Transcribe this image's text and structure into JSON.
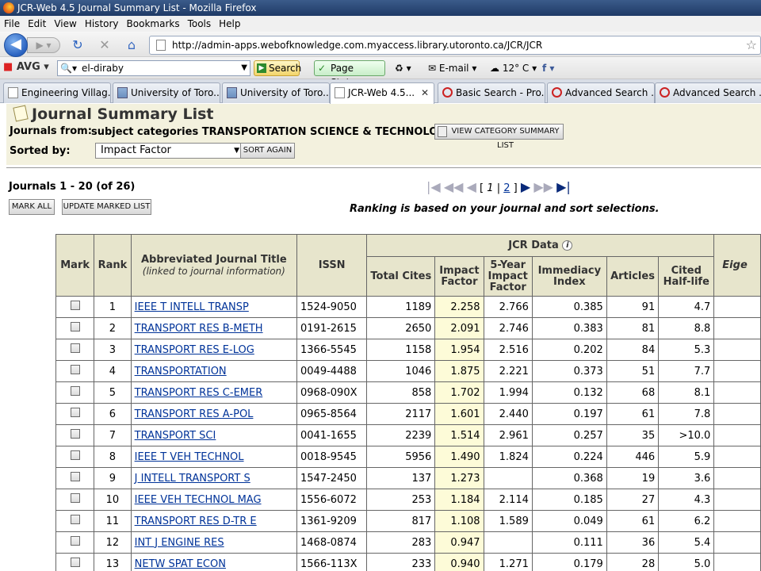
{
  "window": {
    "title": "JCR-Web 4.5 Journal Summary List - Mozilla Firefox"
  },
  "menu": [
    "File",
    "Edit",
    "View",
    "History",
    "Bookmarks",
    "Tools",
    "Help"
  ],
  "nav": {
    "url": "http://admin-apps.webofknowledge.com.myaccess.library.utoronto.ca/JCR/JCR"
  },
  "toolbar2": {
    "avg": "AVG",
    "search_value": "el-diraby",
    "search_btn": "Search",
    "page_status": "Page Status",
    "email": "E-mail",
    "weather": "12° C"
  },
  "tabs": [
    {
      "label": "Engineering Villag...",
      "icon": "doc"
    },
    {
      "label": "University of Toro...",
      "icon": "img"
    },
    {
      "label": "University of Toro...",
      "icon": "img"
    },
    {
      "label": "JCR-Web 4.5...",
      "icon": "doc",
      "active": true
    },
    {
      "label": "Basic Search - Pro...",
      "icon": "q"
    },
    {
      "label": "Advanced Search ...",
      "icon": "q"
    },
    {
      "label": "Advanced Search ...",
      "icon": "q"
    }
  ],
  "page": {
    "title": "Journal Summary List",
    "journals_from_label": "Journals from:",
    "journals_from_value": "subject categories TRANSPORTATION SCIENCE & TECHNOLOGY",
    "view_category_btn": "VIEW CATEGORY SUMMARY LIST",
    "sorted_by_label": "Sorted by:",
    "sorted_by_value": "Impact Factor",
    "sort_again_btn": "SORT AGAIN",
    "journals_count": "Journals 1 - 20 (of 26)",
    "mark_all_btn": "MARK ALL",
    "update_marked_btn": "UPDATE MARKED LIST",
    "pager": {
      "current": "1",
      "next": "2"
    },
    "ranking_note": "Ranking is based on your journal and sort selections."
  },
  "table": {
    "headers": {
      "mark": "Mark",
      "rank": "Rank",
      "title": "Abbreviated Journal Title",
      "title_sub": "(linked to journal information)",
      "issn": "ISSN",
      "jcr_data": "JCR Data",
      "total_cites": "Total Cites",
      "impact_factor": "Impact Factor",
      "five_year": "5-Year Impact Factor",
      "immediacy": "Immediacy Index",
      "articles": "Articles",
      "cited_half_life": "Cited Half-life",
      "eigen": "Eige"
    },
    "rows": [
      {
        "rank": "1",
        "title": "IEEE T INTELL TRANSP",
        "issn": "1524-9050",
        "total_cites": "1189",
        "impact": "2.258",
        "five_year": "2.766",
        "immediacy": "0.385",
        "articles": "91",
        "half_life": "4.7"
      },
      {
        "rank": "2",
        "title": "TRANSPORT RES B-METH",
        "issn": "0191-2615",
        "total_cites": "2650",
        "impact": "2.091",
        "five_year": "2.746",
        "immediacy": "0.383",
        "articles": "81",
        "half_life": "8.8"
      },
      {
        "rank": "3",
        "title": "TRANSPORT RES E-LOG",
        "issn": "1366-5545",
        "total_cites": "1158",
        "impact": "1.954",
        "five_year": "2.516",
        "immediacy": "0.202",
        "articles": "84",
        "half_life": "5.3"
      },
      {
        "rank": "4",
        "title": "TRANSPORTATION",
        "issn": "0049-4488",
        "total_cites": "1046",
        "impact": "1.875",
        "five_year": "2.221",
        "immediacy": "0.373",
        "articles": "51",
        "half_life": "7.7"
      },
      {
        "rank": "5",
        "title": "TRANSPORT RES C-EMER",
        "issn": "0968-090X",
        "total_cites": "858",
        "impact": "1.702",
        "five_year": "1.994",
        "immediacy": "0.132",
        "articles": "68",
        "half_life": "8.1"
      },
      {
        "rank": "6",
        "title": "TRANSPORT RES A-POL",
        "issn": "0965-8564",
        "total_cites": "2117",
        "impact": "1.601",
        "five_year": "2.440",
        "immediacy": "0.197",
        "articles": "61",
        "half_life": "7.8"
      },
      {
        "rank": "7",
        "title": "TRANSPORT SCI",
        "issn": "0041-1655",
        "total_cites": "2239",
        "impact": "1.514",
        "five_year": "2.961",
        "immediacy": "0.257",
        "articles": "35",
        "half_life": ">10.0"
      },
      {
        "rank": "8",
        "title": "IEEE T VEH TECHNOL",
        "issn": "0018-9545",
        "total_cites": "5956",
        "impact": "1.490",
        "five_year": "1.824",
        "immediacy": "0.224",
        "articles": "446",
        "half_life": "5.9"
      },
      {
        "rank": "9",
        "title": "J INTELL TRANSPORT S",
        "issn": "1547-2450",
        "total_cites": "137",
        "impact": "1.273",
        "five_year": "",
        "immediacy": "0.368",
        "articles": "19",
        "half_life": "3.6"
      },
      {
        "rank": "10",
        "title": "IEEE VEH TECHNOL MAG",
        "issn": "1556-6072",
        "total_cites": "253",
        "impact": "1.184",
        "five_year": "2.114",
        "immediacy": "0.185",
        "articles": "27",
        "half_life": "4.3"
      },
      {
        "rank": "11",
        "title": "TRANSPORT RES D-TR E",
        "issn": "1361-9209",
        "total_cites": "817",
        "impact": "1.108",
        "five_year": "1.589",
        "immediacy": "0.049",
        "articles": "61",
        "half_life": "6.2"
      },
      {
        "rank": "12",
        "title": "INT J ENGINE RES",
        "issn": "1468-0874",
        "total_cites": "283",
        "impact": "0.947",
        "five_year": "",
        "immediacy": "0.111",
        "articles": "36",
        "half_life": "5.4"
      },
      {
        "rank": "13",
        "title": "NETW SPAT ECON",
        "issn": "1566-113X",
        "total_cites": "233",
        "impact": "0.940",
        "five_year": "1.271",
        "immediacy": "0.179",
        "articles": "28",
        "half_life": "5.0"
      }
    ]
  },
  "colors": {
    "header_panel": "#f3f1de",
    "table_header": "#e7e5cc",
    "impact_col": "#fdfbd8",
    "link": "#003399"
  }
}
